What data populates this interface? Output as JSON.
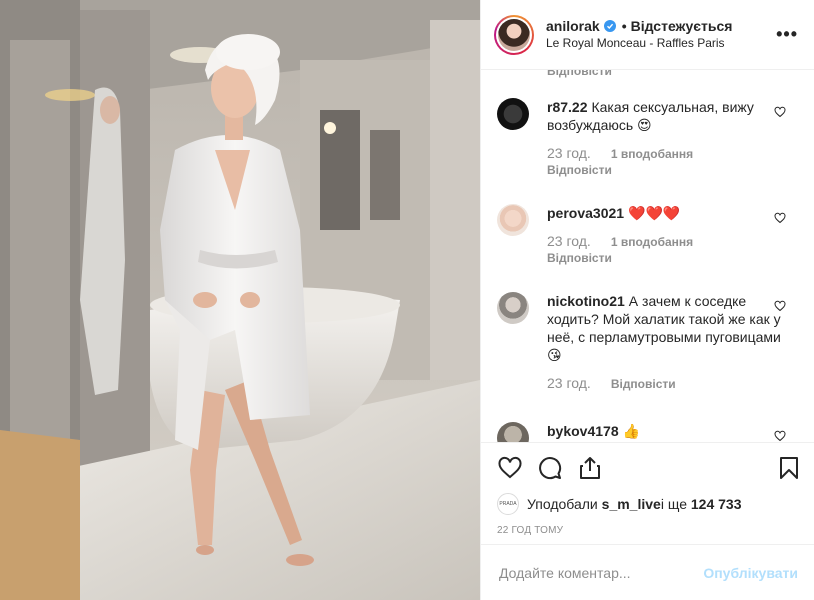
{
  "header": {
    "username": "anilorak",
    "follow_label": "Відстежується",
    "location": "Le Royal Monceau - Raffles Paris",
    "more_label": "•••"
  },
  "comments": {
    "partial_reply": "Відповісти",
    "items": [
      {
        "user": "r87.22",
        "text": "Какая сексуальная, вижу возбуждаюсь 😍",
        "time": "23 год.",
        "likes": "1 вподобання",
        "reply": "Відповісти"
      },
      {
        "user": "perova3021",
        "text": "❤️❤️❤️",
        "time": "23 год.",
        "likes": "1 вподобання",
        "reply": "Відповісти"
      },
      {
        "user": "nickotino21",
        "text": "А зачем к соседке ходить? Мой халатик такой же как у неё, с перламутровыми пуговицами 😘",
        "time": "23 год.",
        "likes": "",
        "reply": "Відповісти"
      },
      {
        "user": "bykov4178",
        "text": "👍",
        "time": "",
        "likes": "",
        "reply": ""
      }
    ]
  },
  "likes": {
    "prefix": "Уподобали ",
    "user": "s_m_live",
    "middle": " і ще ",
    "count": "124 733",
    "avatar_text": "PRADA"
  },
  "timestamp": "22 ГОД ТОМУ",
  "add_comment": {
    "placeholder": "Додайте коментар...",
    "publish_label": "Опублікувати"
  },
  "colors": {
    "verified": "#3897f0",
    "publish_disabled": "#b2dffc",
    "muted": "#8e8e8e"
  }
}
